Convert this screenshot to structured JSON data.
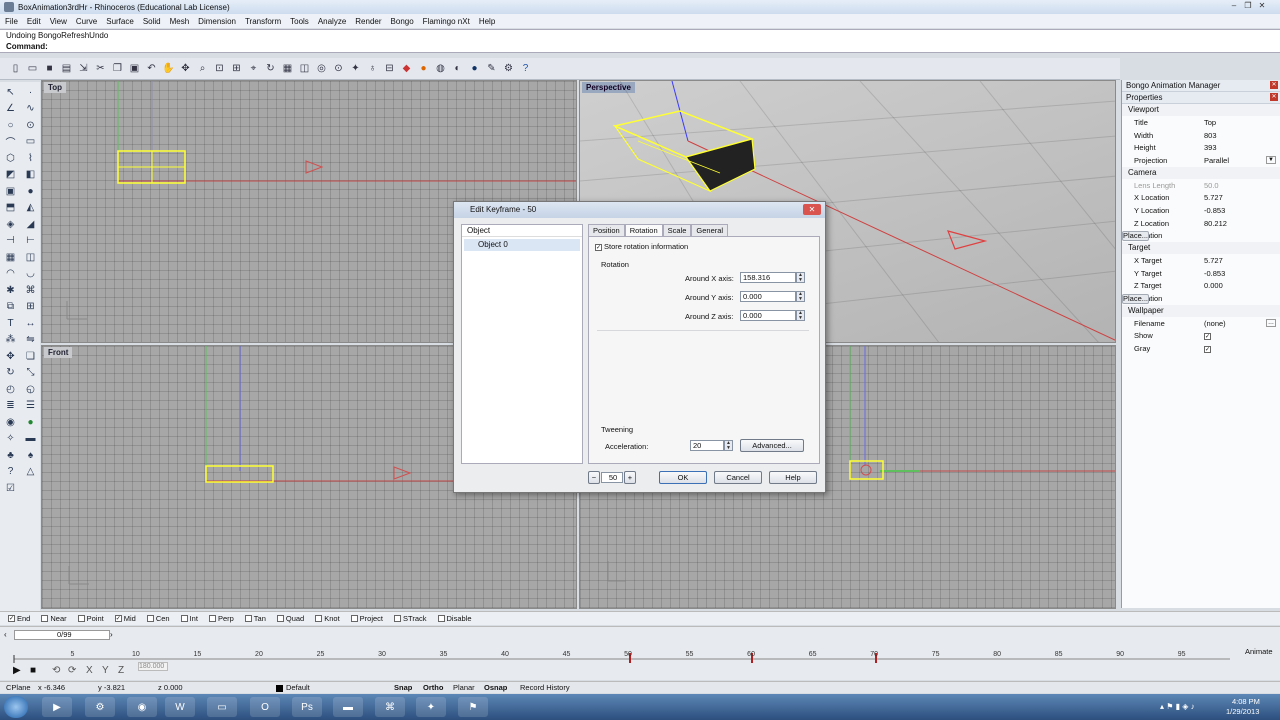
{
  "window": {
    "title": "BoxAnimation3rdHr - Rhinoceros (Educational Lab License)"
  },
  "menu": [
    "File",
    "Edit",
    "View",
    "Curve",
    "Surface",
    "Solid",
    "Mesh",
    "Dimension",
    "Transform",
    "Tools",
    "Analyze",
    "Render",
    "Bongo",
    "Flamingo nXt",
    "Help"
  ],
  "command": {
    "history": "Undoing BongoRefreshUndo",
    "prompt": "Command:"
  },
  "viewports": {
    "top": "Top",
    "perspective": "Perspective",
    "front": "Front"
  },
  "panel": {
    "title": "Bongo Animation Manager",
    "properties": "Properties",
    "viewport_section": "Viewport",
    "viewport": [
      {
        "k": "Title",
        "v": "Top"
      },
      {
        "k": "Width",
        "v": "803"
      },
      {
        "k": "Height",
        "v": "393"
      },
      {
        "k": "Projection",
        "v": "Parallel"
      }
    ],
    "camera_section": "Camera",
    "camera": [
      {
        "k": "Lens Length",
        "v": "50.0"
      },
      {
        "k": "X Location",
        "v": "5.727"
      },
      {
        "k": "Y Location",
        "v": "-0.853"
      },
      {
        "k": "Z Location",
        "v": "80.212"
      },
      {
        "k": "Location",
        "v": "Place..."
      }
    ],
    "target_section": "Target",
    "target": [
      {
        "k": "X Target",
        "v": "5.727"
      },
      {
        "k": "Y Target",
        "v": "-0.853"
      },
      {
        "k": "Z Target",
        "v": "0.000"
      },
      {
        "k": "Location",
        "v": "Place..."
      }
    ],
    "wallpaper_section": "Wallpaper",
    "wallpaper": [
      {
        "k": "Filename",
        "v": "(none)"
      },
      {
        "k": "Show",
        "v": "✓"
      },
      {
        "k": "Gray",
        "v": "✓"
      }
    ]
  },
  "dialog": {
    "title": "Edit Keyframe - 50",
    "object_header": "Object",
    "object_item": "Object 0",
    "tabs": [
      "Position",
      "Rotation",
      "Scale",
      "General"
    ],
    "store_label": "Store rotation information",
    "rotation_group": "Rotation",
    "x_label": "Around X axis:",
    "x_value": "158.316",
    "y_label": "Around Y axis:",
    "y_value": "0.000",
    "z_label": "Around Z axis:",
    "z_value": "0.000",
    "tweening_group": "Tweening",
    "accel_label": "Acceleration:",
    "accel_value": "20",
    "advanced": "Advanced...",
    "frame": "50",
    "minus": "−",
    "plus": "+",
    "ok": "OK",
    "cancel": "Cancel",
    "help": "Help"
  },
  "osnap": [
    "End",
    "Near",
    "Point",
    "Mid",
    "Cen",
    "Int",
    "Perp",
    "Tan",
    "Quad",
    "Knot",
    "Project",
    "STrack",
    "Disable"
  ],
  "timeline": {
    "frame_display": "0/99",
    "ticks": [
      "5",
      "10",
      "15",
      "20",
      "25",
      "30",
      "35",
      "40",
      "45",
      "50",
      "55",
      "60",
      "65",
      "70",
      "75",
      "80",
      "85",
      "90",
      "95"
    ],
    "angle": "180.000",
    "animate": "Animate"
  },
  "status": {
    "cplane": "CPlane",
    "x": "x -6.346",
    "y": "y -3.821",
    "z": "z 0.000",
    "layer": "Default",
    "snap": "Snap",
    "ortho": "Ortho",
    "planar": "Planar",
    "osnap": "Osnap",
    "history": "Record History"
  },
  "clock": {
    "time": "4:08 PM",
    "date": "1/29/2013"
  }
}
